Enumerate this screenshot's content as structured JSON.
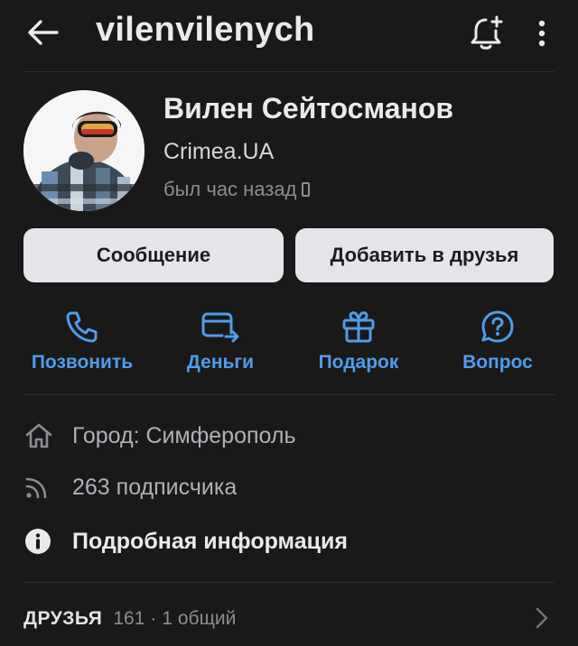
{
  "header": {
    "title": "vilenvilenych",
    "back_icon": "arrow-left-icon",
    "bell_icon": "bell-plus-icon",
    "more_icon": "more-vertical-icon"
  },
  "profile": {
    "name": "Вилен Сейтосманов",
    "org": "Crimea.UA",
    "status": "был час назад",
    "status_icon": "mobile-phone-icon"
  },
  "buttons": {
    "message": "Сообщение",
    "add_friend": "Добавить в друзья"
  },
  "quick_actions": [
    {
      "label": "Позвонить",
      "icon": "phone-icon"
    },
    {
      "label": "Деньги",
      "icon": "money-transfer-icon"
    },
    {
      "label": "Подарок",
      "icon": "gift-icon"
    },
    {
      "label": "Вопрос",
      "icon": "question-bubble-icon"
    }
  ],
  "info": {
    "city": "Город: Симферополь",
    "followers": "263 подписчика",
    "details": "Подробная информация"
  },
  "friends": {
    "title": "ДРУЗЬЯ",
    "count": "161",
    "separator": "·",
    "common": "1 общий"
  },
  "colors": {
    "background": "#19191a",
    "accent": "#4f9cec",
    "button_bg": "#e4e5e8",
    "text_primary": "#e9eaec",
    "text_secondary": "#8a8d92"
  }
}
